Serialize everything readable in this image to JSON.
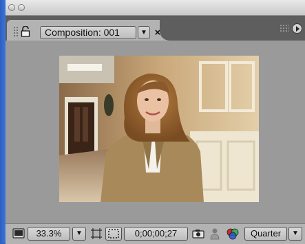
{
  "window": {
    "title_buttons": [
      "close-button",
      "minimize-button"
    ]
  },
  "tab": {
    "label": "Composition: 001",
    "menu_glyph": "▼",
    "close_glyph": "×"
  },
  "toolbar": {
    "magnification": "33.3%",
    "magnification_arrow": "▼",
    "timecode": "0;00;00;27",
    "resolution": "Quarter",
    "resolution_arrow": "▼"
  },
  "icons": {
    "lock": "lock-icon",
    "always_preview": "monitor-icon",
    "region_of_interest": "region-of-interest-icon",
    "transparency_grid": "transparency-grid-icon",
    "snapshot": "camera-icon",
    "show_snapshot": "person-icon",
    "channels": "rgb-channels-icon"
  }
}
